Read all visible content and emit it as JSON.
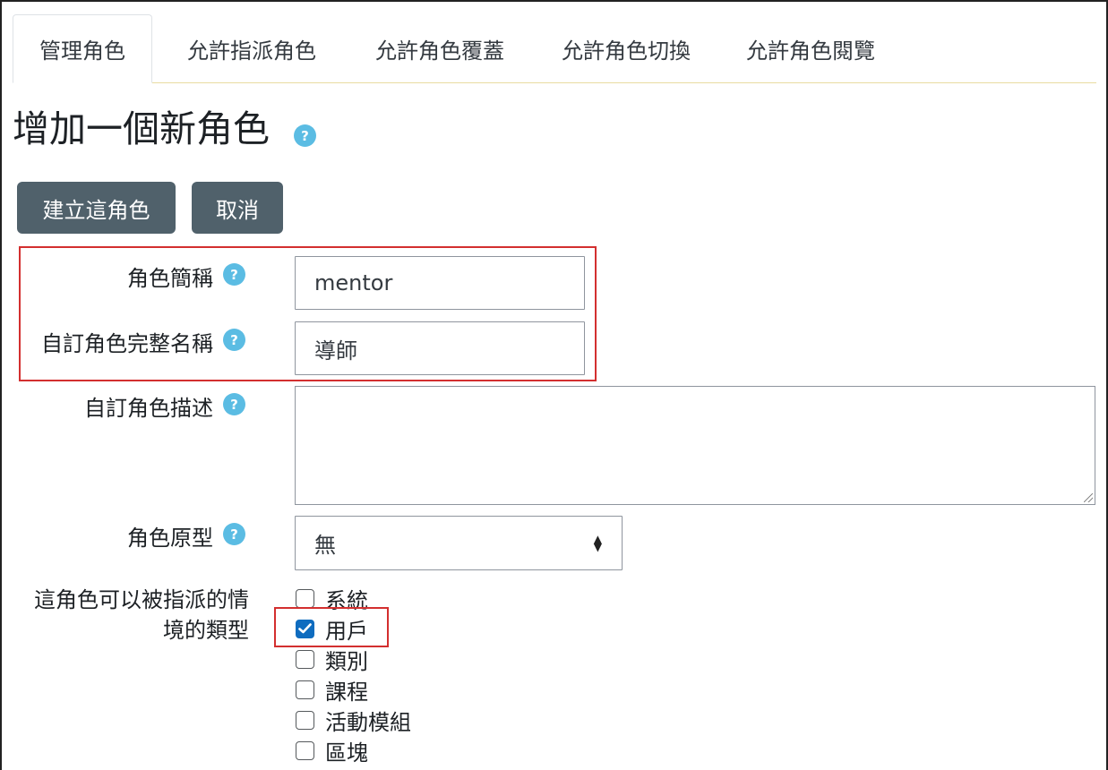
{
  "tabs": [
    {
      "label": "管理角色",
      "active": true
    },
    {
      "label": "允許指派角色",
      "active": false
    },
    {
      "label": "允許角色覆蓋",
      "active": false
    },
    {
      "label": "允許角色切換",
      "active": false
    },
    {
      "label": "允許角色閱覽",
      "active": false
    }
  ],
  "page": {
    "title": "增加一個新角色",
    "help_icon": "?"
  },
  "buttons": {
    "create": "建立這角色",
    "cancel": "取消"
  },
  "form": {
    "shortname": {
      "label": "角色簡稱",
      "value": "mentor"
    },
    "fullname": {
      "label": "自訂角色完整名稱",
      "value": "導師"
    },
    "description": {
      "label": "自訂角色描述",
      "value": ""
    },
    "archetype": {
      "label": "角色原型",
      "selected": "無"
    },
    "context_types": {
      "label_line1": "這角色可以被指派的情",
      "label_line2": "境的類型",
      "options": [
        {
          "label": "系統",
          "checked": false
        },
        {
          "label": "用戶",
          "checked": true
        },
        {
          "label": "類別",
          "checked": false
        },
        {
          "label": "課程",
          "checked": false
        },
        {
          "label": "活動模組",
          "checked": false
        },
        {
          "label": "區塊",
          "checked": false
        }
      ]
    }
  },
  "colors": {
    "button_bg": "#50616b",
    "help_icon": "#5bbce3",
    "highlight": "#d32f2f",
    "checkbox_checked": "#0f6cbf"
  }
}
